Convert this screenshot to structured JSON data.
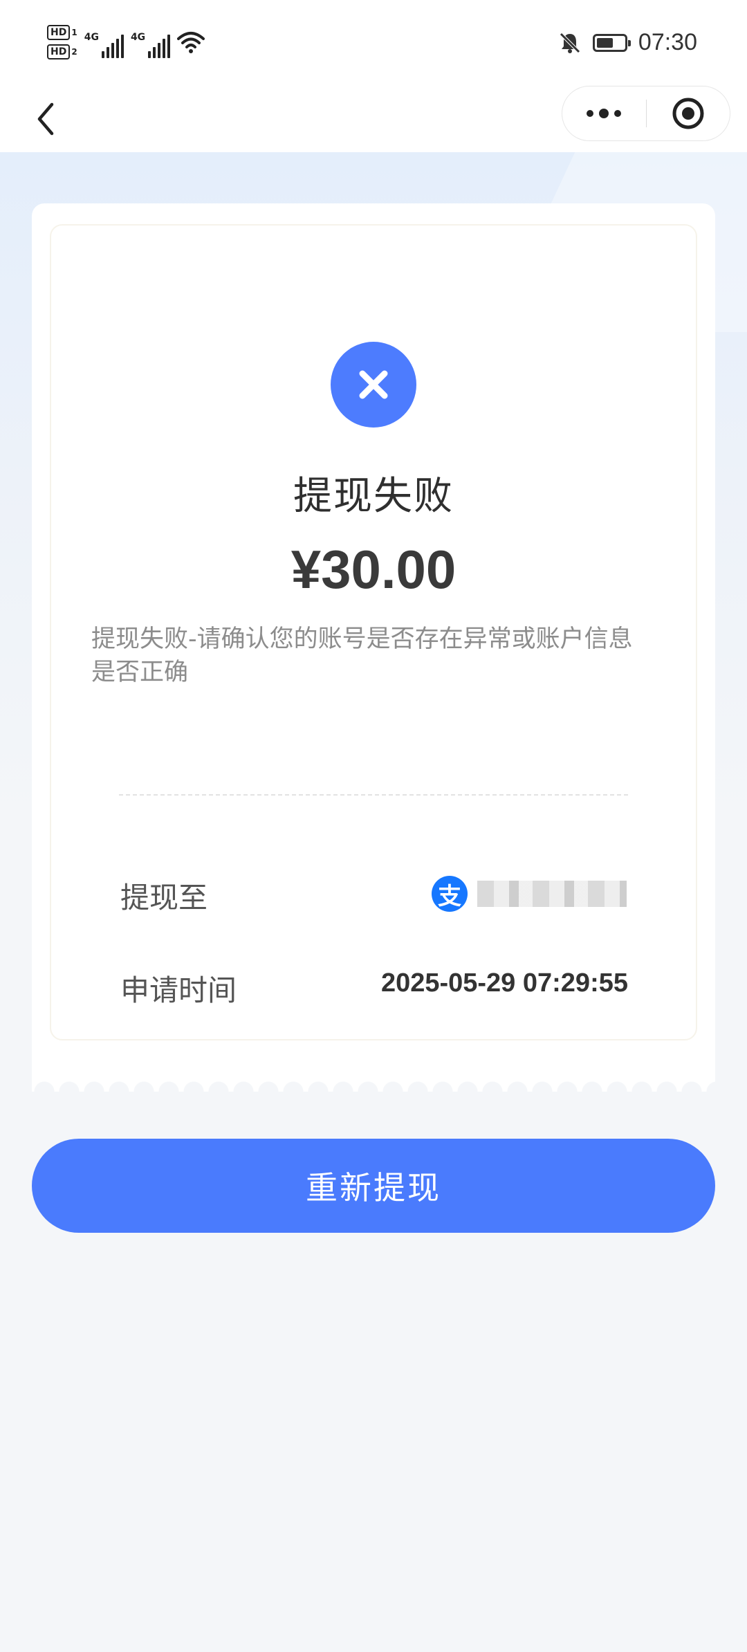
{
  "status_bar": {
    "hd1": "HD",
    "hd1_num": "1",
    "hd2": "HD",
    "hd2_num": "2",
    "net1": "4G",
    "net2": "4G",
    "time": "07:30",
    "battery_level": 0.6
  },
  "nav": {
    "back_icon": "chevron-left-icon",
    "more_icon": "more-dots-icon",
    "close_icon": "target-circle-icon"
  },
  "result": {
    "status_icon": "close-x-icon",
    "status_color": "#4d7cfe",
    "title": "提现失败",
    "amount": "¥30.00",
    "message": "提现失败-请确认您的账号是否存在异常或账户信息是否正确"
  },
  "details": {
    "withdraw_to_label": "提现至",
    "withdraw_to_icon_text": "支",
    "withdraw_to_icon": "alipay-icon",
    "apply_time_label": "申请时间",
    "apply_time_value": "2025-05-29 07:29:55"
  },
  "actions": {
    "retry_label": "重新提现",
    "accent_color": "#4a7bfd"
  }
}
